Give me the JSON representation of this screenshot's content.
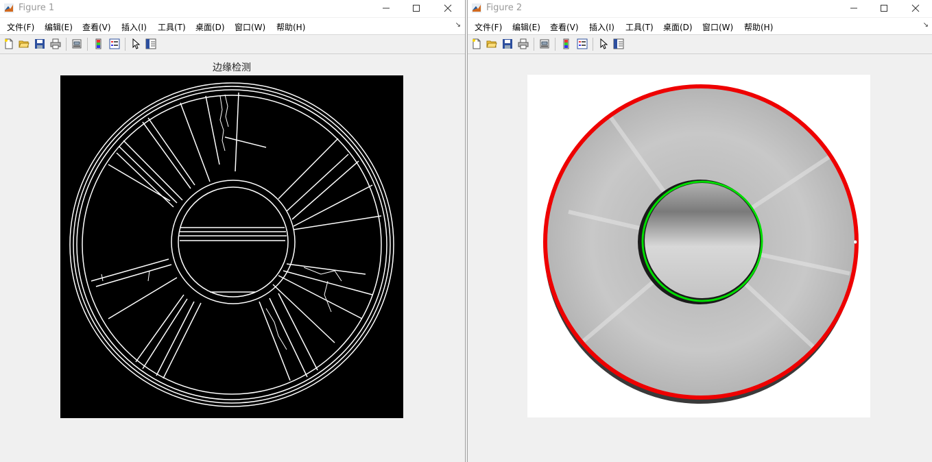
{
  "figure1": {
    "title": "Figure 1",
    "axes_title": "边缘检测",
    "menu": [
      "文件(F)",
      "编辑(E)",
      "查看(V)",
      "插入(I)",
      "工具(T)",
      "桌面(D)",
      "窗口(W)",
      "帮助(H)"
    ],
    "menu_overflow": "↘"
  },
  "figure2": {
    "title": "Figure 2",
    "menu": [
      "文件(F)",
      "编辑(E)",
      "查看(V)",
      "插入(I)",
      "工具(T)",
      "桌面(D)",
      "窗口(W)",
      "帮助(H)"
    ],
    "menu_overflow": "↘"
  },
  "colors": {
    "outer_circle": "#ee0000",
    "inner_circle": "#00dd00",
    "edge_background": "#000000",
    "edge_lines": "#ffffff"
  },
  "toolbar_icons": [
    "new-figure-icon",
    "open-icon",
    "save-icon",
    "print-icon",
    "print-preview-icon",
    "colorbar-icon",
    "legend-icon",
    "pointer-icon",
    "property-editor-icon"
  ]
}
